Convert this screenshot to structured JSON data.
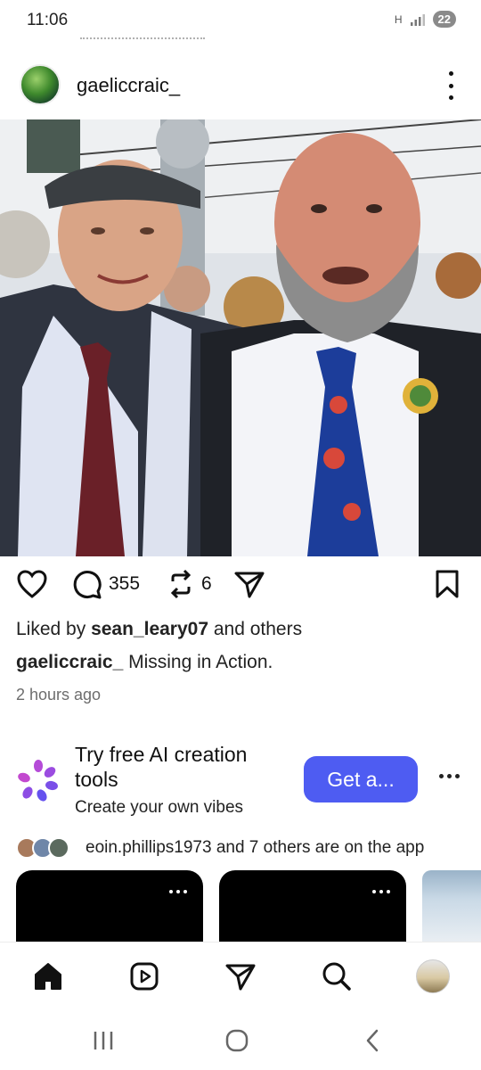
{
  "status_bar": {
    "time": "11:06",
    "network": "H",
    "battery": "22"
  },
  "post": {
    "username": "gaeliccraic_",
    "comment_count": "355",
    "repost_count": "6",
    "liked_by_prefix": "Liked by ",
    "liked_by_user": "sean_leary07",
    "liked_by_suffix": " and others",
    "caption_user": "gaeliccraic_",
    "caption_text": " Missing in Action.",
    "timestamp": "2 hours ago"
  },
  "promo": {
    "title": "Try free AI creation tools",
    "subtitle": "Create your own vibes",
    "button_label": "Get a...",
    "accent_color": "#4e5cf2"
  },
  "friends": {
    "text": "eoin.phillips1973 and 7 others are on the app"
  },
  "icons": {
    "action_bar": [
      "heart-icon",
      "comment-icon",
      "repost-icon",
      "share-icon",
      "bookmark-icon"
    ],
    "bottom_nav": [
      "home-icon",
      "reels-icon",
      "send-icon",
      "search-icon",
      "profile-avatar"
    ],
    "system_nav": [
      "recents-icon",
      "home-circle-icon",
      "back-icon"
    ]
  }
}
